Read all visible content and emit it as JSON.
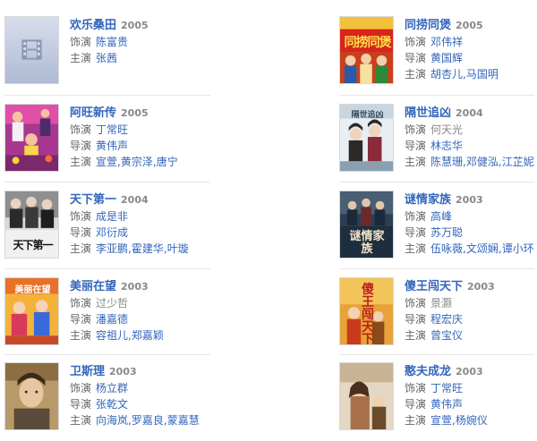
{
  "labels": {
    "role": "饰演",
    "director": "导演",
    "starring": "主演",
    "sep": ","
  },
  "left": [
    {
      "title": "欢乐桑田",
      "year": "2005",
      "role": "陈富贵",
      "starring": [
        "张茜"
      ]
    },
    {
      "title": "阿旺新传",
      "year": "2005",
      "role": "丁常旺",
      "director": "黄伟声",
      "starring": [
        "宣萱",
        "黄宗泽",
        "唐宁"
      ]
    },
    {
      "title": "天下第一",
      "year": "2004",
      "role": "成是非",
      "director": "邓衍成",
      "starring": [
        "李亚鹏",
        "霍建华",
        "叶璇"
      ]
    },
    {
      "title": "美丽在望",
      "year": "2003",
      "role": "过少哲",
      "director": "潘嘉德",
      "starring": [
        "容祖儿",
        "郑嘉颖"
      ]
    },
    {
      "title": "卫斯理",
      "year": "2003",
      "role": "杨立群",
      "director": "张乾文",
      "starring": [
        "向海岚",
        "罗嘉良",
        "蒙嘉慧"
      ]
    }
  ],
  "right": [
    {
      "title": "同捞同煲",
      "year": "2005",
      "role": "邓伟祥",
      "director": "黄国辉",
      "starring": [
        "胡杏儿",
        "马国明"
      ]
    },
    {
      "title": "隔世追凶",
      "year": "2004",
      "role": "何天光",
      "director": "林志华",
      "starring": [
        "陈慧珊",
        "邓健泓",
        "江芷妮"
      ]
    },
    {
      "title": "谜情家族",
      "year": "2003",
      "role": "高峰",
      "director": "苏万聪",
      "starring": [
        "伍咏薇",
        "文颂娴",
        "谭小环"
      ]
    },
    {
      "title": "傻王闯天下",
      "year": "2003",
      "role": "景灏",
      "director": "程宏庆",
      "starring": [
        "曾宝仪"
      ]
    },
    {
      "title": "憨夫成龙",
      "year": "2003",
      "role": "丁常旺",
      "director": "黄伟声",
      "starring": [
        "宣萱",
        "杨婉仪"
      ]
    }
  ],
  "poster_text": {
    "right0": "同捞同煲",
    "right1": "隔世追凶",
    "right2": "谜情家族",
    "right3": "傻王闯天下",
    "left2": "天下第一",
    "left3": "美丽在望"
  }
}
